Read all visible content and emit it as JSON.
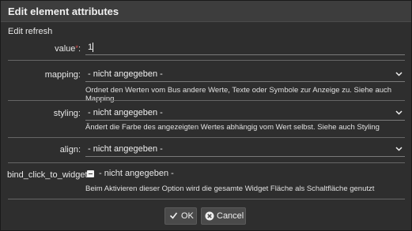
{
  "dialog": {
    "title": "Edit element attributes",
    "section": "Edit refresh"
  },
  "fields": {
    "value": {
      "label": "value",
      "required_mark": "*",
      "colon": ":",
      "value": "1"
    },
    "mapping": {
      "label": "mapping:",
      "selected": "- nicht angegeben -",
      "description": "Ordnet den Werten vom Bus andere Werte, Texte oder Symbole zur Anzeige zu. Siehe auch Mapping"
    },
    "styling": {
      "label": "styling:",
      "selected": "- nicht angegeben -",
      "description": "Ändert die Farbe des angezeigten Wertes abhängig vom Wert selbst. Siehe auch Styling"
    },
    "align": {
      "label": "align:",
      "selected": "- nicht angegeben -"
    },
    "bind_click_to_widget": {
      "label": "bind_click_to_widget:",
      "state": "- nicht angegeben -",
      "description": "Beim Aktivieren dieser Option wird die gesamte Widget Fläche als Schaltfläche genutzt"
    }
  },
  "buttons": {
    "ok": "OK",
    "cancel": "Cancel"
  },
  "icons": {
    "dropdown": "chevron-down-icon",
    "ok": "checkmark-icon",
    "cancel": "cancel-circle-icon"
  },
  "colors": {
    "required": "#e05050",
    "background": "#2e2e2e",
    "titlebar": "#3d3d3d"
  }
}
